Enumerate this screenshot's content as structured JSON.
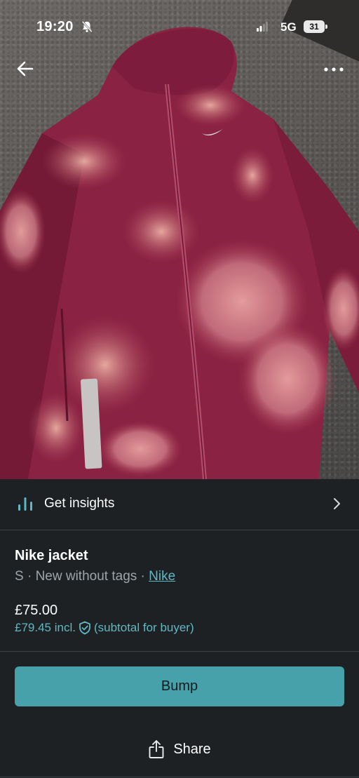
{
  "status_bar": {
    "time": "19:20",
    "network": "5G",
    "battery_level": "31",
    "icons": [
      "bell-off-icon",
      "signal-icon"
    ]
  },
  "header": {
    "back_icon": "arrow-left-icon",
    "more_icon": "more-horizontal-icon"
  },
  "photo": {
    "subject": "jacket-photo"
  },
  "insights": {
    "label": "Get insights",
    "icon": "bar-chart-icon",
    "chevron": "chevron-right-icon"
  },
  "item": {
    "title": "Nike jacket",
    "size": "S",
    "separator": " · ",
    "condition": "New without tags",
    "brand": "Nike",
    "price": "£75.00",
    "buyer_price": "£79.45 incl.",
    "buyer_note": "(subtotal for buyer)"
  },
  "actions": {
    "bump_label": "Bump",
    "share_label": "Share"
  },
  "colors": {
    "background": "#1d2124",
    "accent": "#46a1ab",
    "link": "#5fb8c3",
    "muted_text": "#9ea5aa"
  }
}
